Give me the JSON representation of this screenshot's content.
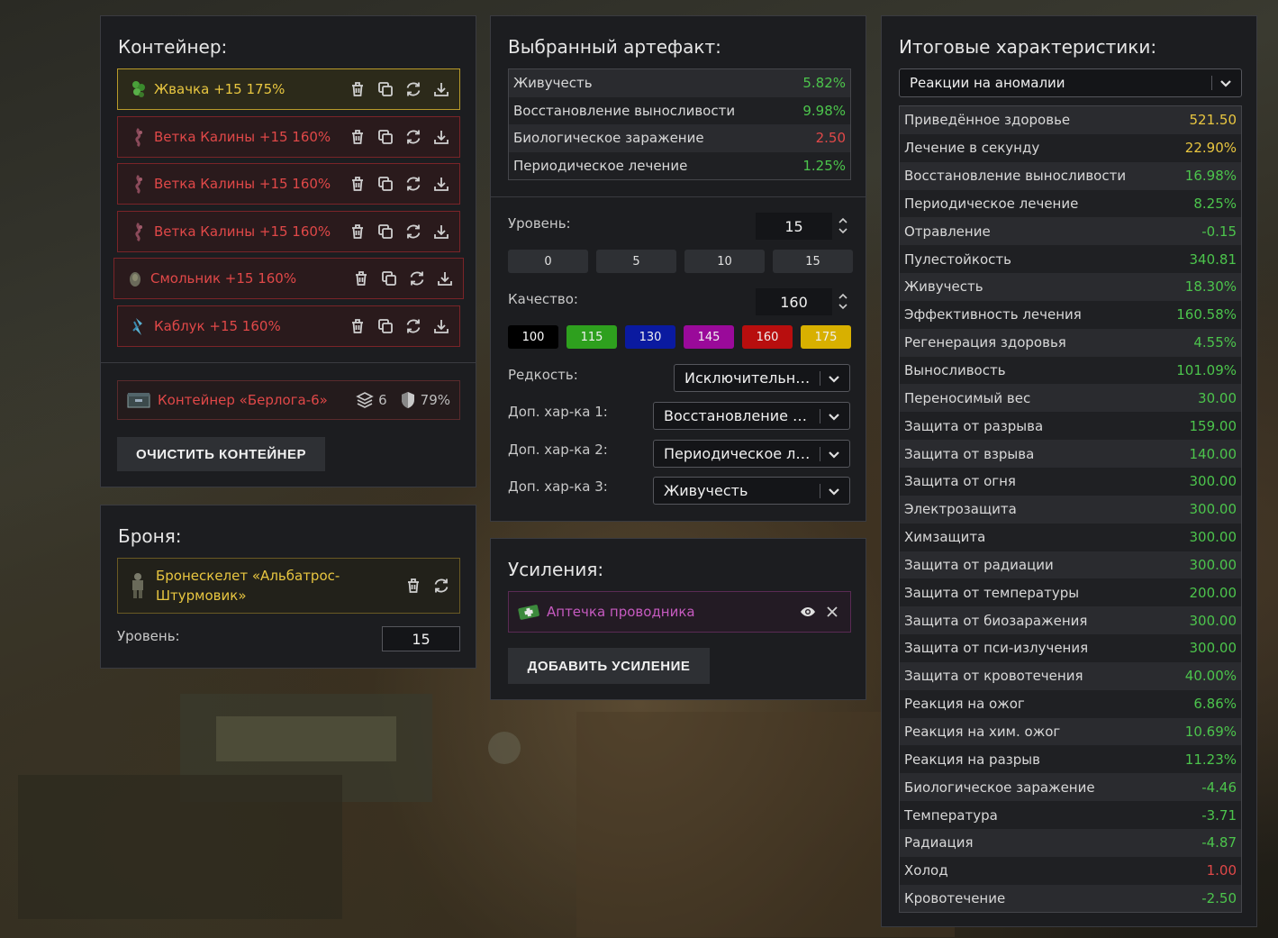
{
  "container_panel": {
    "title": "Контейнер:",
    "artifacts": [
      {
        "name": "Жвачка +15 175%",
        "rarity": "gold",
        "icon": "gum-artifact-icon"
      },
      {
        "name": "Ветка Калины +15 160%",
        "rarity": "red",
        "icon": "kalina-branch-icon"
      },
      {
        "name": "Ветка Калины +15 160%",
        "rarity": "red",
        "icon": "kalina-branch-icon"
      },
      {
        "name": "Ветка Калины +15 160%",
        "rarity": "red",
        "icon": "kalina-branch-icon"
      },
      {
        "name": "Смольник +15 160%",
        "rarity": "red",
        "icon": "smolnik-icon"
      },
      {
        "name": "Каблук +15 160%",
        "rarity": "red",
        "icon": "kabluk-icon"
      }
    ],
    "container": {
      "name": "Контейнер «Берлога-6»",
      "slots": "6",
      "protection": "79%"
    },
    "clear_button": "ОЧИСТИТЬ КОНТЕЙНЕР"
  },
  "armor_panel": {
    "title": "Броня:",
    "armor_name": "Бронескелет «Альбатрос-Штурмовик»",
    "level_label": "Уровень:",
    "level_value": "15"
  },
  "selected_panel": {
    "title": "Выбранный артефакт:",
    "stats": [
      {
        "name": "Живучесть",
        "value": "5.82%",
        "color": "green"
      },
      {
        "name": "Восстановление выносливости",
        "value": "9.98%",
        "color": "green"
      },
      {
        "name": "Биологическое заражение",
        "value": "2.50",
        "color": "red"
      },
      {
        "name": "Периодическое лечение",
        "value": "1.25%",
        "color": "green"
      }
    ],
    "level_label": "Уровень:",
    "level_value": "15",
    "level_buttons": [
      "0",
      "5",
      "10",
      "15"
    ],
    "quality_label": "Качество:",
    "quality_value": "160",
    "quality_buttons": [
      {
        "label": "100",
        "bg": "#000000",
        "fg": "#ffffff"
      },
      {
        "label": "115",
        "bg": "#2ea01e",
        "fg": "#f0f0f0"
      },
      {
        "label": "130",
        "bg": "#0a1aa0",
        "fg": "#f0f0f0"
      },
      {
        "label": "145",
        "bg": "#9a0a9a",
        "fg": "#f0f0f0"
      },
      {
        "label": "160",
        "bg": "#b80e0e",
        "fg": "#f0f0f0"
      },
      {
        "label": "175",
        "bg": "#d8b000",
        "fg": "#f0f0f0"
      }
    ],
    "rarity_label": "Редкость:",
    "rarity_value": "Исключительный",
    "extra1_label": "Доп. хар-ка 1:",
    "extra1_value": "Восстановление выносливости",
    "extra2_label": "Доп. хар-ка 2:",
    "extra2_value": "Периодическое лечение",
    "extra3_label": "Доп. хар-ка 3:",
    "extra3_value": "Живучесть"
  },
  "boost_panel": {
    "title": "Усиления:",
    "boost_name": "Аптечка проводника",
    "add_button": "ДОБАВИТЬ УСИЛЕНИЕ"
  },
  "total_panel": {
    "title": "Итоговые характеристики:",
    "filter_value": "Реакции на аномалии",
    "stats": [
      {
        "name": "Приведённое здоровье",
        "value": "521.50",
        "color": "gold"
      },
      {
        "name": "Лечение в секунду",
        "value": "22.90%",
        "color": "gold"
      },
      {
        "name": "Восстановление выносливости",
        "value": "16.98%",
        "color": "green"
      },
      {
        "name": "Периодическое лечение",
        "value": "8.25%",
        "color": "green"
      },
      {
        "name": "Отравление",
        "value": "-0.15",
        "color": "green"
      },
      {
        "name": "Пулестойкость",
        "value": "340.81",
        "color": "green"
      },
      {
        "name": "Живучесть",
        "value": "18.30%",
        "color": "green"
      },
      {
        "name": "Эффективность лечения",
        "value": "160.58%",
        "color": "green"
      },
      {
        "name": "Регенерация здоровья",
        "value": "4.55%",
        "color": "green"
      },
      {
        "name": "Выносливость",
        "value": "101.09%",
        "color": "green"
      },
      {
        "name": "Переносимый вес",
        "value": "30.00",
        "color": "green"
      },
      {
        "name": "Защита от разрыва",
        "value": "159.00",
        "color": "green"
      },
      {
        "name": "Защита от взрыва",
        "value": "140.00",
        "color": "green"
      },
      {
        "name": "Защита от огня",
        "value": "300.00",
        "color": "green"
      },
      {
        "name": "Электрозащита",
        "value": "300.00",
        "color": "green"
      },
      {
        "name": "Химзащита",
        "value": "300.00",
        "color": "green"
      },
      {
        "name": "Защита от радиации",
        "value": "300.00",
        "color": "green"
      },
      {
        "name": "Защита от температуры",
        "value": "200.00",
        "color": "green"
      },
      {
        "name": "Защита от биозаражения",
        "value": "300.00",
        "color": "green"
      },
      {
        "name": "Защита от пси-излучения",
        "value": "300.00",
        "color": "green"
      },
      {
        "name": "Защита от кровотечения",
        "value": "40.00%",
        "color": "green"
      },
      {
        "name": "Реакция на ожог",
        "value": "6.86%",
        "color": "green"
      },
      {
        "name": "Реакция на хим. ожог",
        "value": "10.69%",
        "color": "green"
      },
      {
        "name": "Реакция на разрыв",
        "value": "11.23%",
        "color": "green"
      },
      {
        "name": "Биологическое заражение",
        "value": "-4.46",
        "color": "green"
      },
      {
        "name": "Температура",
        "value": "-3.71",
        "color": "green"
      },
      {
        "name": "Радиация",
        "value": "-4.87",
        "color": "green"
      },
      {
        "name": "Холод",
        "value": "1.00",
        "color": "red"
      },
      {
        "name": "Кровотечение",
        "value": "-2.50",
        "color": "green"
      }
    ]
  }
}
